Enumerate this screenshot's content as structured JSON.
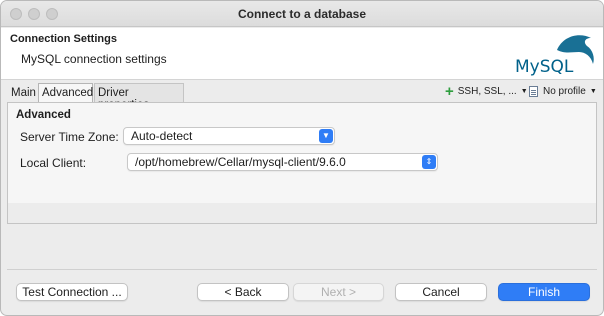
{
  "window": {
    "title": "Connect to a database"
  },
  "header": {
    "title": "Connection Settings",
    "subtitle": "MySQL connection settings",
    "logo_text": "MySQL"
  },
  "tabs": [
    {
      "label": "Main",
      "active": false
    },
    {
      "label": "Advanced",
      "active": true
    },
    {
      "label": "Driver properties",
      "active": false
    }
  ],
  "toolbar": {
    "ssh_label": "SSH, SSL, ...",
    "profile_label": "No profile",
    "icons": [
      "plus-icon",
      "document-icon"
    ]
  },
  "advanced": {
    "group_title": "Advanced",
    "timezone_label": "Server Time Zone:",
    "timezone_value": "Auto-detect",
    "client_label": "Local Client:",
    "client_value": "/opt/homebrew/Cellar/mysql-client/9.6.0"
  },
  "buttons": {
    "test": "Test Connection ...",
    "back": "< Back",
    "next": "Next >",
    "cancel": "Cancel",
    "finish": "Finish"
  },
  "colors": {
    "accent": "#2f7df6",
    "mysql_blue": "#00618a",
    "mysql_orange": "#e48e00",
    "plus_green": "#2e9e3e"
  }
}
